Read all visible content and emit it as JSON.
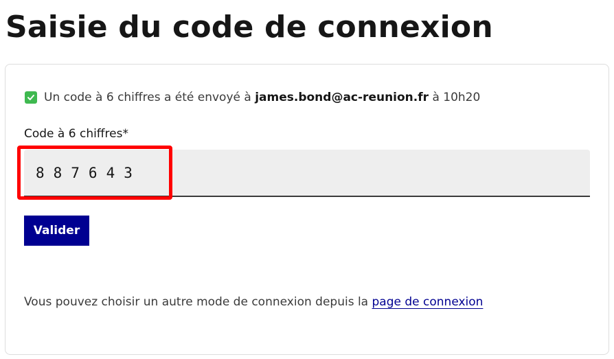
{
  "page": {
    "title": "Saisie du code de connexion"
  },
  "status": {
    "icon": "check-square-icon",
    "icon_color": "#3fb950",
    "prefix": "Un code à 6 chiffres a été envoyé à",
    "email": "james.bond@ac-reunion.fr",
    "suffix": "à 10h20"
  },
  "form": {
    "code_label": "Code à 6 chiffres*",
    "code_value": "887643",
    "submit_label": "Valider",
    "accent_color": "#000091"
  },
  "footer": {
    "text": "Vous pouvez choisir un autre mode de connexion depuis la",
    "link_label": "page de connexion"
  }
}
